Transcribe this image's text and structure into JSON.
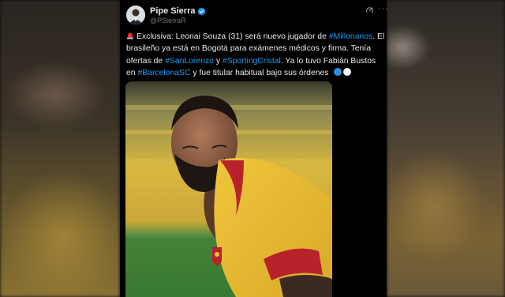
{
  "author": {
    "name": "Pipe Sierra",
    "handle": "@PSierraR"
  },
  "tweet": {
    "t1": "Exclusiva: Leonai Souza (31) será nuevo jugador de ",
    "h1": "#Millonarios",
    "t2": ". El brasileño ya está en Bogotá para exámenes médicos y firma. Tenía ofertas de ",
    "h2": "#SanLorenzo",
    "t3": " y ",
    "h3": "#SportingCristal",
    "t4": ". Ya lo tuvo Fabián Bustos en ",
    "h4": "#BarcelonaSC",
    "t5": " y fue titular habitual bajo sus órdenes"
  },
  "icons": {
    "verified": "verified-badge-icon",
    "grok": "grok-icon",
    "more": "more-options-icon",
    "siren": "siren-emoji-icon",
    "flags": "blue-white-circle-emoji-icons"
  },
  "colors": {
    "hashtag": "#1d9bf0",
    "text": "#e7e9ea",
    "muted": "#71767b",
    "background": "#000000"
  }
}
